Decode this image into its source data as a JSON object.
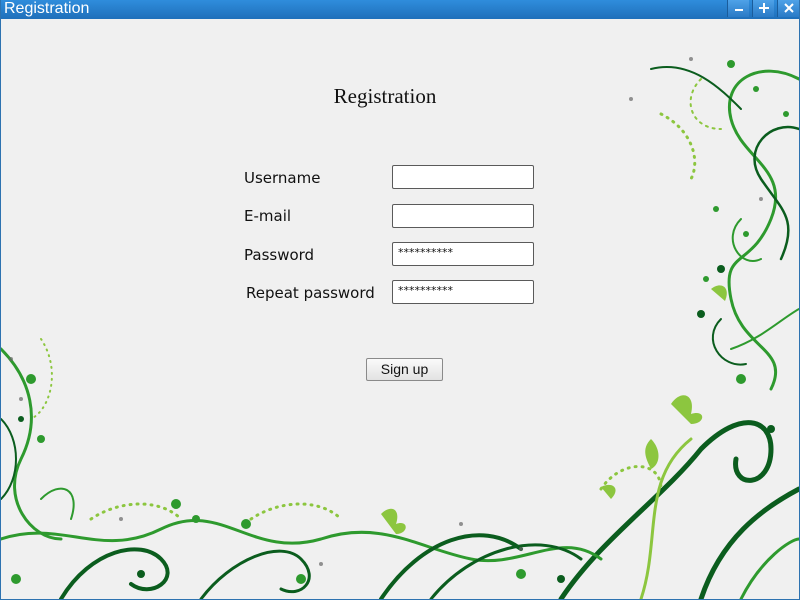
{
  "window": {
    "title": "Registration"
  },
  "form": {
    "heading": "Registration",
    "username_label": "Username",
    "username_value": "",
    "email_label": "E-mail",
    "email_value": "",
    "password_label": "Password",
    "password_value": "**********",
    "repeat_password_label": "Repeat password",
    "repeat_password_value": "**********",
    "signup_label": "Sign up"
  },
  "colors": {
    "titlebar": "#1f6fba",
    "background": "#f0f0f0",
    "vine_dark": "#0b5d1e",
    "vine_mid": "#2e9a2e",
    "vine_light": "#8cc63f"
  }
}
